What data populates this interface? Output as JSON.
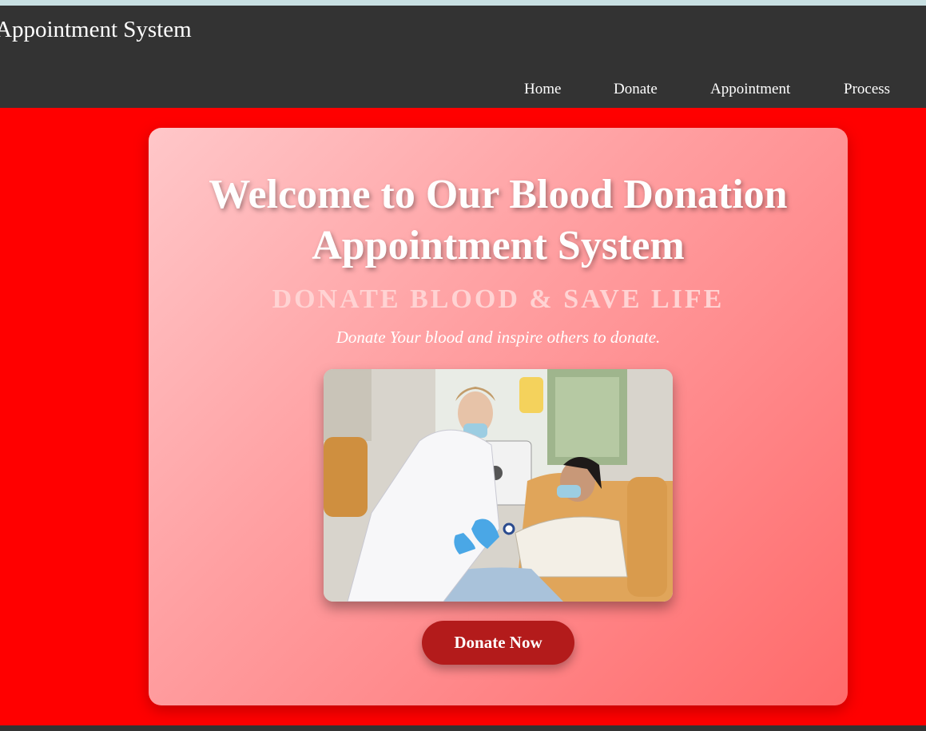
{
  "header": {
    "site_title": "Appointment System",
    "nav": [
      {
        "label": "Home"
      },
      {
        "label": "Donate"
      },
      {
        "label": "Appointment"
      },
      {
        "label": "Process"
      }
    ]
  },
  "hero": {
    "title": "Welcome to Our Blood Donation Appointment System",
    "subtitle": "DONATE BLOOD & SAVE LIFE",
    "tagline": "Donate Your blood and inspire others to donate.",
    "cta_label": "Donate Now"
  },
  "colors": {
    "header_bg": "#333333",
    "main_bg": "#ff0000",
    "cta_bg": "#b31b1b",
    "card_gradient_start": "#ffc7c9",
    "card_gradient_end": "#ff6a6a"
  }
}
